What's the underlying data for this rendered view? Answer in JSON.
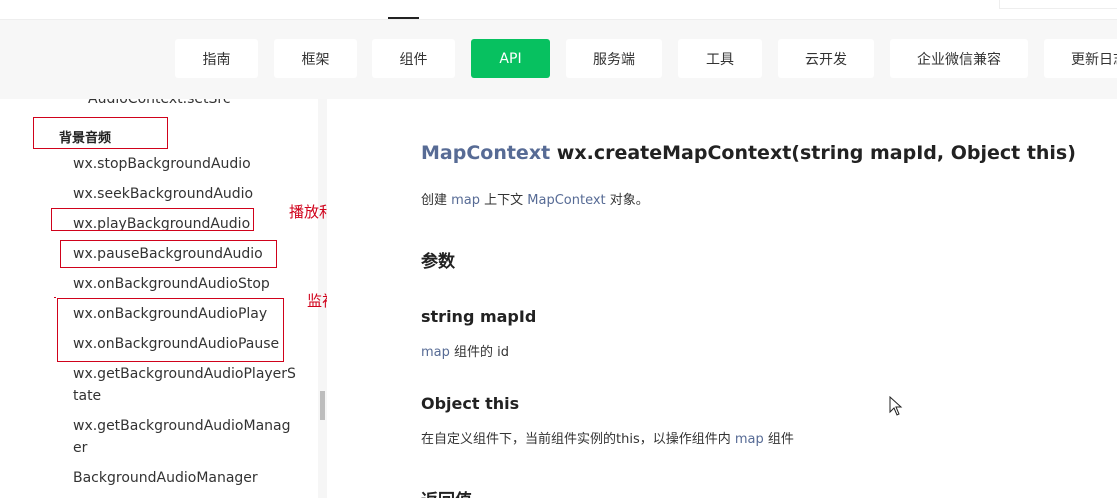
{
  "nav": {
    "tabs": [
      {
        "label": "指南"
      },
      {
        "label": "框架"
      },
      {
        "label": "组件"
      },
      {
        "label": "API"
      },
      {
        "label": "服务端"
      },
      {
        "label": "工具"
      },
      {
        "label": "云开发"
      },
      {
        "label": "企业微信兼容"
      },
      {
        "label": "更新日志"
      }
    ],
    "active_label": "API"
  },
  "sidebar": {
    "partial_item": "AudioContext.setSrc",
    "section_heading": "背景音频",
    "items": [
      "wx.stopBackgroundAudio",
      "wx.seekBackgroundAudio",
      "wx.playBackgroundAudio",
      "wx.pauseBackgroundAudio",
      "wx.onBackgroundAudioStop",
      "wx.onBackgroundAudioPlay",
      "wx.onBackgroundAudioPause",
      "wx.getBackgroundAudioPlayerS",
      "tate",
      "wx.getBackgroundAudioManag",
      "er",
      "BackgroundAudioManager"
    ]
  },
  "annotations": {
    "play_pause": "播放和暂停",
    "listen_play_pause": "监视播放和暂停"
  },
  "content": {
    "title_link": "MapContext",
    "title_rest": " wx.createMapContext(string mapId, Object this)",
    "desc_prefix": "创建 ",
    "desc_map": "map",
    "desc_mid": " 上下文 ",
    "desc_ctx": "MapContext",
    "desc_suffix": " 对象。",
    "params_heading": "参数",
    "param1_name": "string mapId",
    "param1_link": "map",
    "param1_desc": " 组件的 id",
    "param2_name": "Object this",
    "param2_desc_prefix": "在自定义组件下，当前组件实例的this，以操作组件内 ",
    "param2_link": "map",
    "param2_desc_suffix": " 组件",
    "return_heading": "返回值"
  },
  "colors": {
    "accent": "#07c160",
    "link": "#576b95",
    "annotation": "#d0021b"
  }
}
